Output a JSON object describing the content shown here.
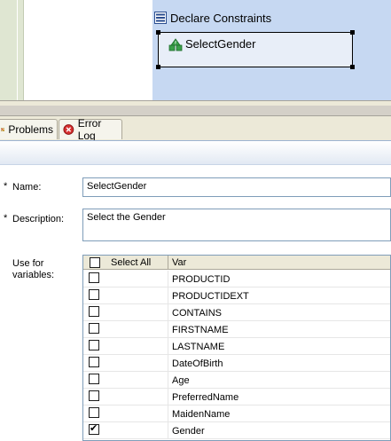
{
  "diagram": {
    "constraints_title": "Declare Constraints",
    "node_label": "SelectGender",
    "colors": {
      "lane": "#dfe6d2",
      "panel": "#c6d8f2",
      "node": "#e8eef8"
    }
  },
  "tabs": [
    {
      "label": "Problems",
      "icon": "problems-icon"
    },
    {
      "label": "Error Log",
      "icon": "error-log-icon"
    }
  ],
  "form": {
    "name_label": "Name:",
    "name_value": "SelectGender",
    "description_label": "Description:",
    "description_value": "Select the Gender",
    "use_for_label_line1": "Use for",
    "use_for_label_line2": "variables:",
    "required_marker": "*"
  },
  "var_table": {
    "select_all_label": "Select All",
    "var_header": "Var",
    "rows": [
      {
        "name": "PRODUCTID",
        "checked": false
      },
      {
        "name": "PRODUCTIDEXT",
        "checked": false
      },
      {
        "name": "CONTAINS",
        "checked": false
      },
      {
        "name": "FIRSTNAME",
        "checked": false
      },
      {
        "name": "LASTNAME",
        "checked": false
      },
      {
        "name": "DateOfBirth",
        "checked": false
      },
      {
        "name": "Age",
        "checked": false
      },
      {
        "name": "PreferredName",
        "checked": false
      },
      {
        "name": "MaidenName",
        "checked": false
      },
      {
        "name": "Gender",
        "checked": true
      }
    ]
  }
}
